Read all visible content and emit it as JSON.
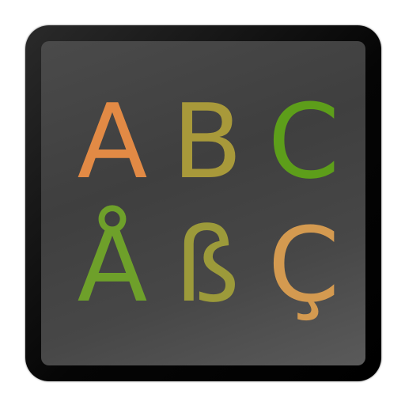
{
  "icon": {
    "row1": [
      {
        "glyph": "A",
        "color": "#e28a45"
      },
      {
        "glyph": "B",
        "color": "#a8993a"
      },
      {
        "glyph": "C",
        "color": "#5d9e1a"
      }
    ],
    "row2": [
      {
        "glyph": "Å",
        "color": "#6ea02a"
      },
      {
        "glyph": "ß",
        "color": "#9c9a3a"
      },
      {
        "glyph": "Ç",
        "color": "#d49a50"
      }
    ]
  }
}
